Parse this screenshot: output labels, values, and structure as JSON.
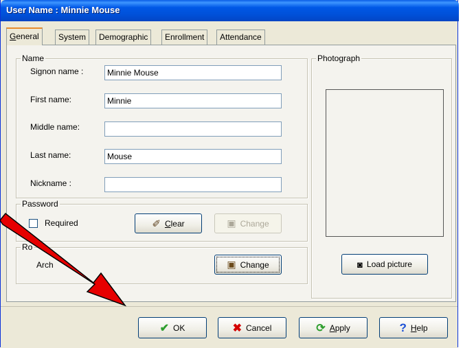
{
  "window": {
    "title": "User Name : Minnie Mouse"
  },
  "tabs": [
    {
      "label": "General",
      "active": true
    },
    {
      "label": "System"
    },
    {
      "label": "Demographic"
    },
    {
      "label": "Enrollment"
    },
    {
      "label": "Attendance"
    }
  ],
  "name_group": {
    "title": "Name",
    "signon_label": "Signon name :",
    "signon_value": "Minnie Mouse",
    "first_label": "First name:",
    "first_value": "Minnie",
    "middle_label": "Middle name:",
    "middle_value": "",
    "last_label": "Last name:",
    "last_value": "Mouse",
    "nickname_label": "Nickname :",
    "nickname_value": ""
  },
  "password_group": {
    "title": "Password",
    "required_label": "Required",
    "required_checked": false,
    "clear_label": "Clear",
    "change_label": "Change"
  },
  "role_group": {
    "title": "Ro",
    "role_value": "Arch",
    "change_label": "Change"
  },
  "photo_group": {
    "title": "Photograph",
    "load_label": "Load picture"
  },
  "footer": {
    "ok_label": "OK",
    "cancel_label": "Cancel",
    "apply_label": "Apply",
    "help_label": "Help"
  },
  "colors": {
    "titlebar": "#0058e6",
    "arrow": "#e60000",
    "ok_icon": "#2e9e2e",
    "cancel_icon": "#d40000",
    "help_icon": "#1a4fd6"
  }
}
